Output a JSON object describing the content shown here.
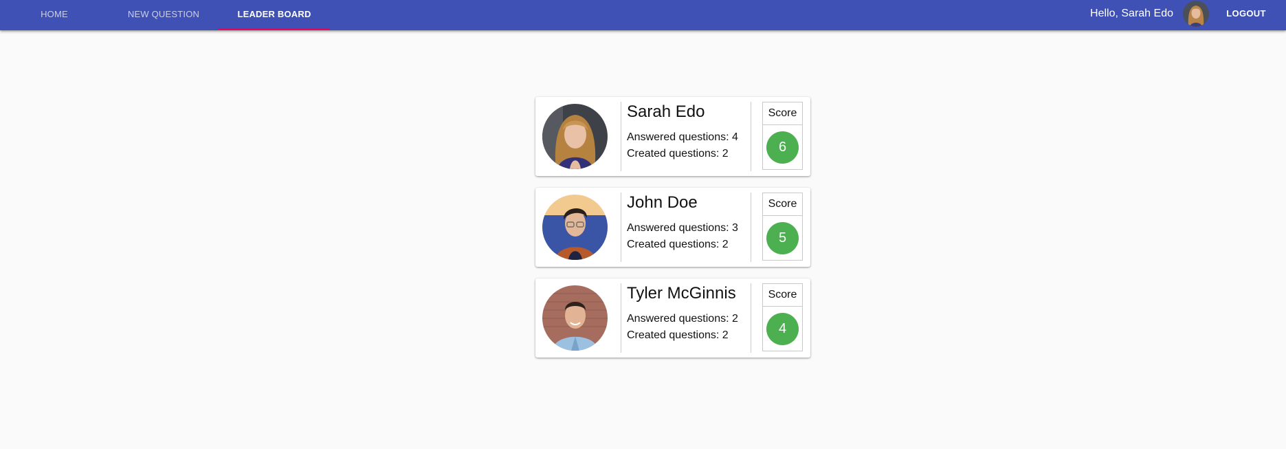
{
  "nav": {
    "tabs": [
      {
        "label": "HOME"
      },
      {
        "label": "NEW QUESTION"
      },
      {
        "label": "LEADER BOARD"
      }
    ],
    "active_tab": "LEADER BOARD",
    "greeting": "Hello, Sarah Edo",
    "logout_label": "LOGOUT"
  },
  "colors": {
    "appbar": "#3f51b5",
    "tab_indicator": "#f50057",
    "score_badge": "#4caf50"
  },
  "leaderboard": [
    {
      "name": "Sarah Edo",
      "answered": "Answered questions: 4",
      "created": "Created questions: 2",
      "score_label": "Score",
      "score": "6"
    },
    {
      "name": "John Doe",
      "answered": "Answered questions: 3",
      "created": "Created questions: 2",
      "score_label": "Score",
      "score": "5"
    },
    {
      "name": "Tyler McGinnis",
      "answered": "Answered questions: 2",
      "created": "Created questions: 2",
      "score_label": "Score",
      "score": "4"
    }
  ]
}
